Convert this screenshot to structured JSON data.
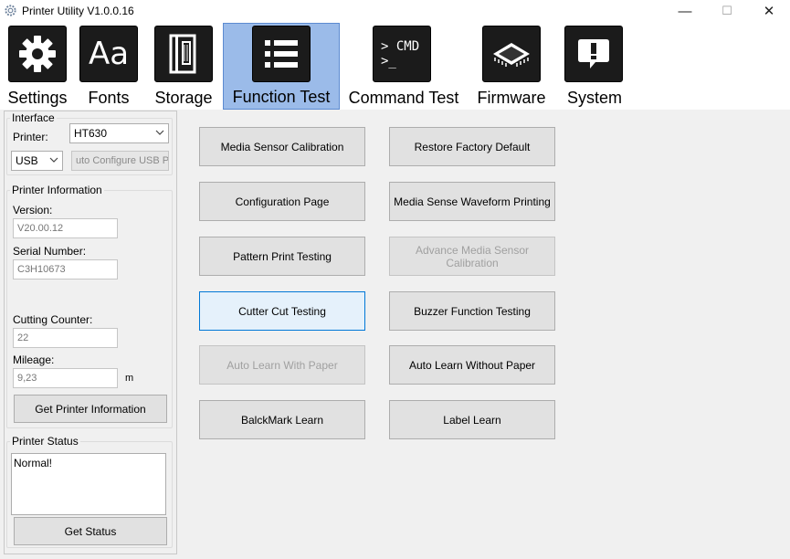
{
  "window": {
    "title": "Printer Utility  V1.0.0.16",
    "minimize": "—",
    "maximize": "☐",
    "close": "✕"
  },
  "toolbar": {
    "items": [
      {
        "label": "Settings",
        "icon": "gear-icon"
      },
      {
        "label": "Fonts",
        "icon": "font-icon",
        "glyph": "Aa"
      },
      {
        "label": "Storage",
        "icon": "storage-icon"
      },
      {
        "label": "Function Test",
        "icon": "list-icon",
        "active": true
      },
      {
        "label": "Command Test",
        "icon": "cmd-icon",
        "glyph_line1": "> CMD",
        "glyph_line2": ">_"
      },
      {
        "label": "Firmware",
        "icon": "chip-icon"
      },
      {
        "label": "System",
        "icon": "alert-icon"
      }
    ]
  },
  "interface": {
    "legend": "Interface",
    "printer_label": "Printer:",
    "printer_value": "HT630",
    "port_value": "USB",
    "auto_configure": "uto Configure USB Pc"
  },
  "printer_info": {
    "legend": "Printer Information",
    "version_label": "Version:",
    "version_value": "V20.00.12",
    "serial_label": "Serial Number:",
    "serial_value": "C3H10673",
    "cutting_label": "Cutting Counter:",
    "cutting_value": "22",
    "mileage_label": "Mileage:",
    "mileage_value": "9,23",
    "mileage_unit": "m",
    "get_info_button": "Get Printer Information"
  },
  "printer_status": {
    "legend": "Printer Status",
    "status_text": "Normal!",
    "get_status_button": "Get Status"
  },
  "function_tests": {
    "left": [
      {
        "label": "Media Sensor Calibration",
        "state": "normal"
      },
      {
        "label": "Configuration Page",
        "state": "normal"
      },
      {
        "label": "Pattern Print Testing",
        "state": "normal"
      },
      {
        "label": "Cutter Cut Testing",
        "state": "focused"
      },
      {
        "label": "Auto Learn With Paper",
        "state": "disabled"
      },
      {
        "label": "BalckMark Learn",
        "state": "normal"
      }
    ],
    "right": [
      {
        "label": "Restore Factory Default",
        "state": "normal"
      },
      {
        "label": "Media Sense Waveform Printing",
        "state": "normal"
      },
      {
        "label": "Advance Media Sensor Calibration",
        "state": "disabled"
      },
      {
        "label": "Buzzer Function Testing",
        "state": "normal"
      },
      {
        "label": "Auto Learn Without Paper",
        "state": "normal"
      },
      {
        "label": "Label Learn",
        "state": "normal"
      }
    ]
  }
}
